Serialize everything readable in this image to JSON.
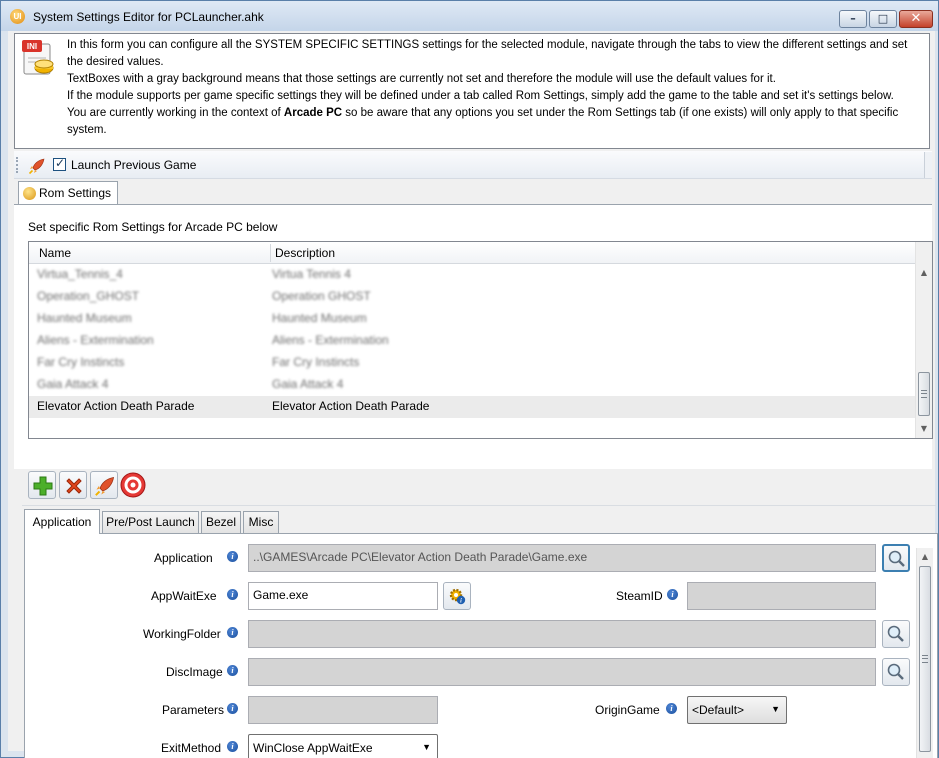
{
  "window": {
    "title": "System Settings Editor for PCLauncher.ahk",
    "app_icon_text": "UI",
    "min_glyph": "–",
    "max_glyph": "□",
    "close_glyph": "✕"
  },
  "info": {
    "line1": "In this form you can configure all the SYSTEM SPECIFIC SETTINGS settings for the selected module, navigate through the tabs to view the different settings and set the desired values.",
    "line2": "TextBoxes with a gray background means that those settings are currently not set and therefore the module will use the default values for it.",
    "line3": "If the module supports per game specific settings they will be defined under a tab called Rom Settings, simply add the game to the table and set it's settings below.",
    "line4_pre": "You are currently working in the context of ",
    "line4_bold": "Arcade PC",
    "line4_post": " so be aware that any options you set under the Rom Settings tab (if one exists) will only apply to that specific system.",
    "icon_text": "INI"
  },
  "toolbar": {
    "launch_previous_label": "Launch Previous Game",
    "launch_previous_checked": true,
    "check_glyph": "✓"
  },
  "rom_tab": {
    "label": "Rom Settings",
    "caption": "Set specific Rom Settings for Arcade PC below"
  },
  "grid": {
    "columns": [
      "Name",
      "Description"
    ],
    "rows": [
      {
        "name": "Virtua_Tennis_4",
        "description": "Virtua Tennis 4",
        "blurred": true
      },
      {
        "name": "Operation_GHOST",
        "description": "Operation GHOST",
        "blurred": true
      },
      {
        "name": "Haunted Museum",
        "description": "Haunted Museum",
        "blurred": true
      },
      {
        "name": "Aliens - Extermination",
        "description": "Aliens - Extermination",
        "blurred": true
      },
      {
        "name": "Far Cry Instincts",
        "description": "Far Cry Instincts",
        "blurred": true
      },
      {
        "name": "Gaia Attack 4",
        "description": "Gaia Attack 4",
        "blurred": true
      },
      {
        "name": "Elevator Action Death Parade",
        "description": "Elevator Action Death Parade",
        "blurred": false,
        "selected": true
      }
    ],
    "scroll_up": "▲",
    "scroll_down": "▼"
  },
  "sub_tabs": [
    "Application",
    "Pre/Post Launch",
    "Bezel",
    "Misc"
  ],
  "fields": {
    "info_glyph": "i",
    "application": {
      "label": "Application",
      "value": "..\\GAMES\\Arcade PC\\Elevator Action Death Parade\\Game.exe"
    },
    "appwaitexe": {
      "label": "AppWaitExe",
      "value": "Game.exe"
    },
    "steamid": {
      "label": "SteamID",
      "value": ""
    },
    "workingfolder": {
      "label": "WorkingFolder",
      "value": ""
    },
    "discimage": {
      "label": "DiscImage",
      "value": ""
    },
    "parameters": {
      "label": "Parameters",
      "value": ""
    },
    "origingame": {
      "label": "OriginGame",
      "value": "<Default>"
    },
    "exitmethod": {
      "label": "ExitMethod",
      "value": "WinClose AppWaitExe"
    },
    "dropdown_arrow": "▼"
  }
}
